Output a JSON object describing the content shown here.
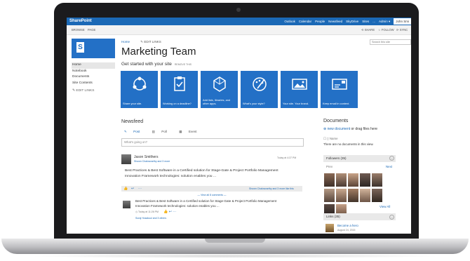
{
  "suite_bar": {
    "brand": "SharePoint",
    "links": [
      "Outlook",
      "Calendar",
      "People",
      "Newsfeed",
      "SkyDrive",
      "Sites",
      "...",
      "Admin ▾"
    ],
    "user": "John Smi"
  },
  "ribbon": {
    "tabs": [
      "BROWSE",
      "PAGE"
    ],
    "actions": [
      "SHARE",
      "FOLLOW",
      "SYNC"
    ]
  },
  "quick_launch": {
    "items": [
      "Home",
      "Notebook",
      "Documents",
      "Site Contents"
    ],
    "edit_links": "EDIT LINKS"
  },
  "breadcrumb": {
    "home": "Home",
    "edit_links": "EDIT LINKS"
  },
  "search": {
    "placeholder": "Search this site"
  },
  "page": {
    "title": "Marketing Team",
    "get_started": "Get started with your site",
    "remove_this": "REMOVE THIS"
  },
  "tiles": [
    {
      "label": "Share your site.",
      "icon": "share-icon"
    },
    {
      "label": "Working on a deadline?",
      "icon": "clipboard-check-icon"
    },
    {
      "label": "Add lists, libraries, and other apps.",
      "icon": "apps-hexagon-icon"
    },
    {
      "label": "What's your style?",
      "icon": "palette-icon"
    },
    {
      "label": "Your site. Your brand.",
      "icon": "landscape-image-icon"
    },
    {
      "label": "Keep email in context.",
      "icon": "mail-card-icon"
    }
  ],
  "newsfeed": {
    "heading": "Newsfeed",
    "tabs": [
      "Post",
      "Poll",
      "Event"
    ],
    "placeholder": "What's going on?",
    "post": {
      "author": "Jason Smithers",
      "meta": "Shown Chakravarthy and 3 more",
      "time": "Today at 4:37 PM",
      "text1": "Best Practices & Best Software in a Certified solution for Stage-Gate & Project Portfolio Management",
      "text2": "Innovation Framework technologies: solution enables you ...",
      "likes": "Shown Chakravarthy and 3 more like this",
      "view_all": "— View all 8 comments —"
    },
    "reply": {
      "text1": "Best Practices & Best Software in a Certified solution for Stage-Gate & Project Portfolio Management",
      "text2": "Innovation Framework technologies: solution enables you ...",
      "time": "Today at 11:26 PM",
      "likes": "Suraj Hosakuul and 3 others"
    }
  },
  "documents": {
    "heading": "Documents",
    "new_document": "new document",
    "drag_text": "or drag files here",
    "column": "Name",
    "empty": "There are no documents in this view."
  },
  "followers": {
    "heading": "Followers (35)",
    "prev": "Prev",
    "next": "Next",
    "view_all": "View All"
  },
  "links": {
    "heading": "Links (35)",
    "item_title": "Become a hero",
    "item_date": "August 24, 2015"
  }
}
